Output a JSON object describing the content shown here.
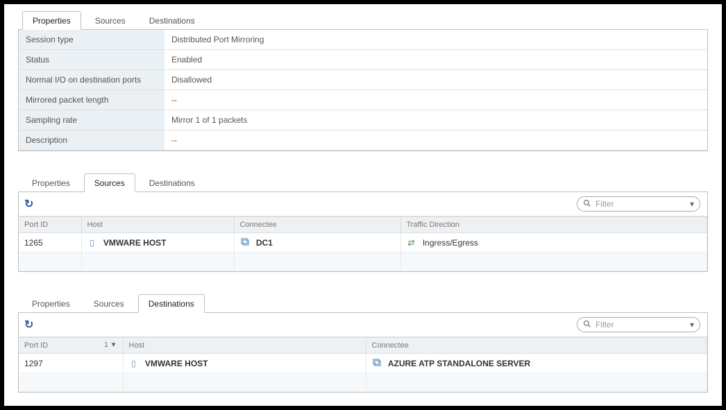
{
  "tabs": {
    "properties": "Properties",
    "sources": "Sources",
    "destinations": "Destinations"
  },
  "panel1": {
    "rows": {
      "session_type": {
        "label": "Session type",
        "value": "Distributed Port Mirroring"
      },
      "status": {
        "label": "Status",
        "value": "Enabled"
      },
      "normal_io": {
        "label": "Normal I/O on destination ports",
        "value": "Disallowed"
      },
      "mirrored_len": {
        "label": "Mirrored packet length",
        "value": "--"
      },
      "sampling_rate": {
        "label": "Sampling rate",
        "value": "Mirror 1 of 1 packets"
      },
      "description": {
        "label": "Description",
        "value": "--"
      }
    }
  },
  "panel2": {
    "headers": {
      "port_id": "Port ID",
      "host": "Host",
      "connectee": "Connectee",
      "traffic_dir": "Traffic Direction"
    },
    "row": {
      "port_id": "1265",
      "host": "VMWARE HOST",
      "connectee": "DC1",
      "traffic_dir": "Ingress/Egress"
    }
  },
  "panel3": {
    "headers": {
      "port_id": "Port ID",
      "sort_ind": "1 ▼",
      "host": "Host",
      "connectee": "Connectee"
    },
    "row": {
      "port_id": "1297",
      "host": "VMWARE HOST",
      "connectee": "AZURE ATP STANDALONE SERVER"
    }
  },
  "filter": {
    "placeholder": "Filter"
  }
}
